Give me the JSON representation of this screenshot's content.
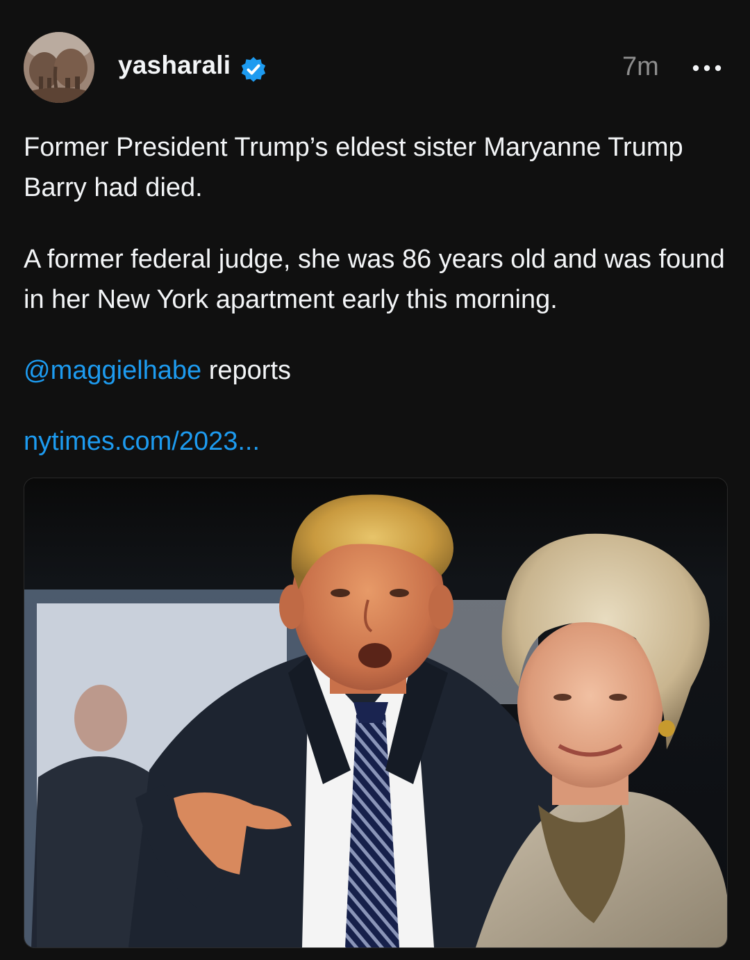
{
  "post": {
    "username": "yasharali",
    "timestamp": "7m",
    "paragraph1": "Former President Trump’s eldest sister Maryanne Trump Barry had died.",
    "paragraph2": "A former federal judge, she was 86 years old and was found in her New York apartment early this morning.",
    "mention": "@maggielhabe",
    "mention_suffix": " reports",
    "link_text": "nytimes.com/2023...",
    "icons": {
      "verified": "verified-badge-icon",
      "more": "more-options-icon"
    },
    "colors": {
      "background": "#101010",
      "text": "#f3f5f7",
      "muted": "#8d8d8d",
      "link": "#1d9bf0",
      "verified": "#1d9bf0"
    }
  }
}
